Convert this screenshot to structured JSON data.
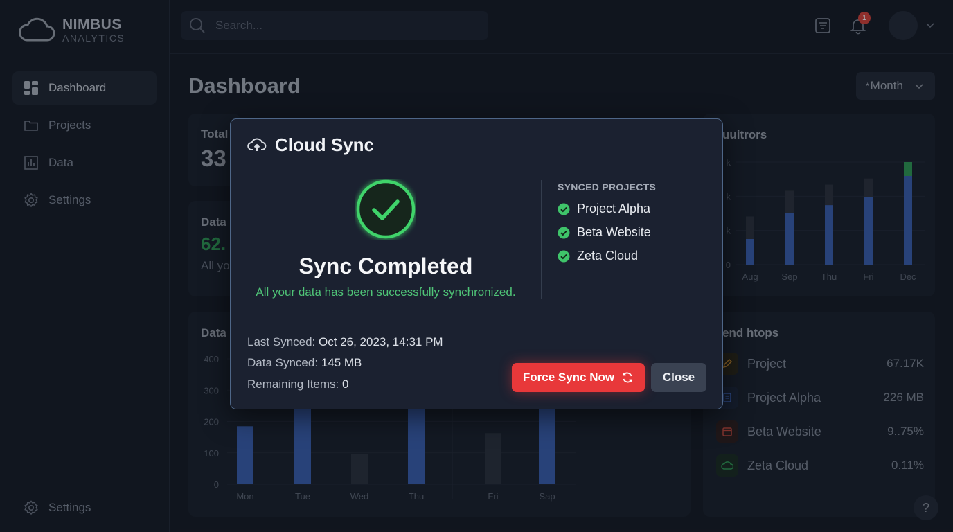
{
  "brand": {
    "name": "NIMBUS",
    "sub": "ANALYTICS"
  },
  "sidebar": {
    "items": [
      {
        "label": "Dashboard",
        "icon": "dashboard-icon",
        "active": true
      },
      {
        "label": "Projects",
        "icon": "folder-icon"
      },
      {
        "label": "Data",
        "icon": "bar-chart-icon"
      },
      {
        "label": "Settings",
        "icon": "gear-icon"
      }
    ],
    "footer_item": {
      "label": "Settings",
      "icon": "gear-icon"
    }
  },
  "topbar": {
    "search_placeholder": "Search...",
    "notification_count": "1"
  },
  "page": {
    "title": "Dashboard",
    "period": "Month",
    "period_prefix": "*"
  },
  "cards": {
    "total": {
      "label": "Total",
      "value": "33"
    },
    "data": {
      "label": "Data",
      "value": "62.",
      "sub": "All yo"
    },
    "visitors": {
      "label": "uuitrors",
      "y_ticks": [
        "k",
        "k",
        "k",
        "0"
      ],
      "chart_data": {
        "type": "bar",
        "categories": [
          "Aug",
          "Sep",
          "Thu",
          "Fri",
          "Dec"
        ],
        "series": [
          {
            "values": [
              25,
              50,
              58,
              66,
              100
            ]
          },
          {
            "values": [
              47,
              72,
              78,
              84,
              100
            ]
          }
        ]
      }
    },
    "data_chart": {
      "label": "Data",
      "y_ticks": [
        "400",
        "300",
        "200",
        "100",
        "0"
      ],
      "chart_data": {
        "type": "bar",
        "categories": [
          "Mon",
          "Tue",
          "Wed",
          "Thu",
          "Fri",
          "Sap"
        ],
        "values": [
          185,
          260,
          97,
          280,
          163,
          300
        ],
        "ylim": [
          0,
          400
        ],
        "highlight": [
          true,
          true,
          false,
          true,
          false,
          true
        ]
      }
    },
    "trends": {
      "label": "end htops",
      "rows": [
        {
          "name": "Project",
          "value": "67.17K",
          "icon": "edit-icon",
          "color": "#c8892d"
        },
        {
          "name": "Project Alpha",
          "value": "226 MB",
          "icon": "document-icon",
          "color": "#3d63b8"
        },
        {
          "name": "Beta Website",
          "value": "9..75%",
          "icon": "calendar-icon",
          "color": "#c0473c"
        },
        {
          "name": "Zeta Cloud",
          "value": "0.11%",
          "icon": "cloud-icon",
          "color": "#2f9a55"
        }
      ]
    }
  },
  "modal": {
    "title": "Cloud Sync",
    "heading": "Sync Completed",
    "subtitle": "All your data has been successfully synchronized.",
    "synced_title": "SYNCED PROJECTS",
    "synced_projects": [
      "Project Alpha",
      "Beta Website",
      "Zeta Cloud"
    ],
    "meta": [
      {
        "key": "Last Synced:",
        "value": "Oct 26, 2023, 14:31 PM"
      },
      {
        "key": "Data Synced:",
        "value": "145 MB"
      },
      {
        "key": "Remaining Items:",
        "value": "0"
      }
    ],
    "force_label": "Force Sync Now",
    "close_label": "Close"
  },
  "help_label": "?",
  "colors": {
    "accent_green": "#4fc477",
    "danger": "#e8383a",
    "bar_blue": "#3d63b8"
  }
}
